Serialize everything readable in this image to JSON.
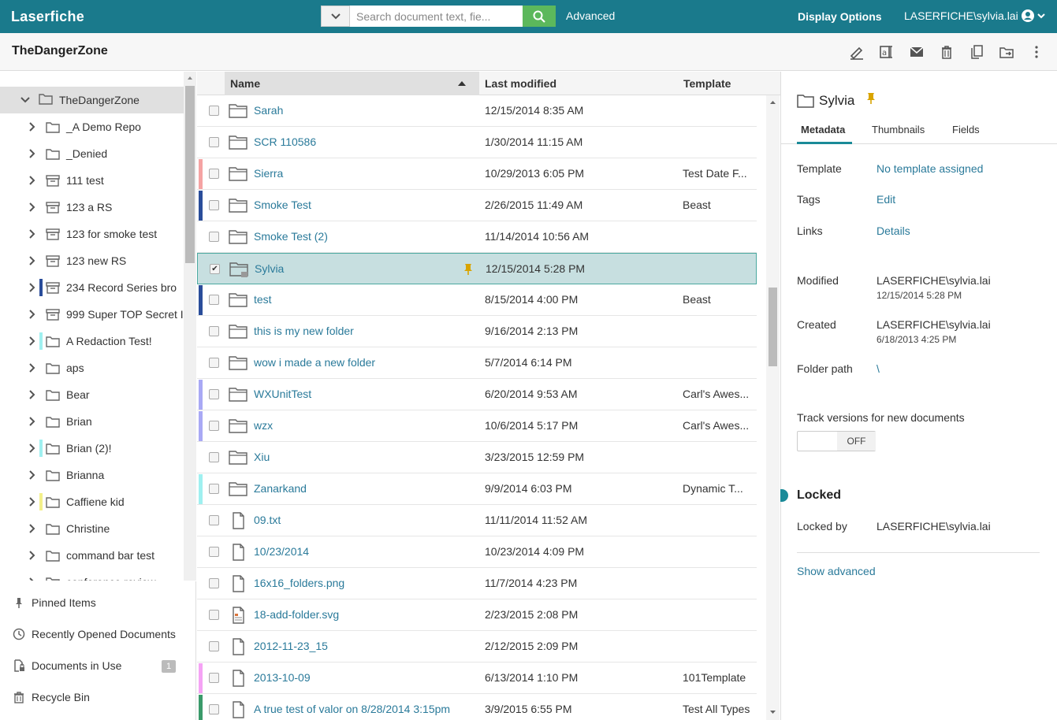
{
  "app": {
    "brand": "Laserfiche"
  },
  "search": {
    "placeholder": "Search document text, fie...",
    "advanced_label": "Advanced"
  },
  "header": {
    "display_options": "Display Options",
    "user": "LASERFICHE\\sylvia.lai"
  },
  "page": {
    "title": "TheDangerZone"
  },
  "tree": {
    "root": "TheDangerZone",
    "items": [
      {
        "label": "_A Demo Repo",
        "icon": "folder",
        "bar": ""
      },
      {
        "label": "_Denied",
        "icon": "folder",
        "bar": ""
      },
      {
        "label": "111 test",
        "icon": "record-series",
        "bar": ""
      },
      {
        "label": "123 a RS",
        "icon": "record-series",
        "bar": ""
      },
      {
        "label": "123 for smoke test",
        "icon": "record-series",
        "bar": ""
      },
      {
        "label": "123 new RS",
        "icon": "record-series",
        "bar": ""
      },
      {
        "label": "234 Record Series bro",
        "icon": "record-series",
        "bar": "#2a4d9a"
      },
      {
        "label": "999 Super TOP Secret I",
        "icon": "record-series",
        "bar": ""
      },
      {
        "label": "A Redaction Test!",
        "icon": "folder",
        "bar": "#9ff0f0"
      },
      {
        "label": "aps",
        "icon": "folder",
        "bar": ""
      },
      {
        "label": "Bear",
        "icon": "folder",
        "bar": ""
      },
      {
        "label": "Brian",
        "icon": "folder",
        "bar": ""
      },
      {
        "label": "Brian (2)!",
        "icon": "folder",
        "bar": "#9ff0f0"
      },
      {
        "label": "Brianna",
        "icon": "folder",
        "bar": ""
      },
      {
        "label": "Caffiene kid",
        "icon": "folder",
        "bar": "#f3f08a"
      },
      {
        "label": "Christine",
        "icon": "folder",
        "bar": ""
      },
      {
        "label": "command bar test",
        "icon": "folder",
        "bar": ""
      },
      {
        "label": "conference review",
        "icon": "folder",
        "bar": ""
      }
    ]
  },
  "left_bottom": {
    "pinned": "Pinned Items",
    "recent": "Recently Opened Documents",
    "in_use": "Documents in Use",
    "in_use_count": "1",
    "recycle": "Recycle Bin"
  },
  "table": {
    "columns": {
      "name": "Name",
      "modified": "Last modified",
      "template": "Template"
    },
    "rows": [
      {
        "name": "Sarah",
        "modified": "12/15/2014 8:35 AM",
        "template": "",
        "type": "folder",
        "accent": ""
      },
      {
        "name": "SCR 110586",
        "modified": "1/30/2014 11:15 AM",
        "template": "",
        "type": "folder",
        "accent": ""
      },
      {
        "name": "Sierra",
        "modified": "10/29/2013 6:05 PM",
        "template": "Test Date F...",
        "type": "folder",
        "accent": "#f5a3a3"
      },
      {
        "name": "Smoke Test",
        "modified": "2/26/2015 11:49 AM",
        "template": "Beast",
        "type": "folder",
        "accent": "#2a4d9a"
      },
      {
        "name": "Smoke Test (2)",
        "modified": "11/14/2014 10:56 AM",
        "template": "",
        "type": "folder",
        "accent": ""
      },
      {
        "name": "Sylvia",
        "modified": "12/15/2014 5:28 PM",
        "template": "",
        "type": "folder-locked",
        "accent": "",
        "selected": true,
        "pinned": true
      },
      {
        "name": "test",
        "modified": "8/15/2014 4:00 PM",
        "template": "Beast",
        "type": "folder",
        "accent": "#2a4d9a"
      },
      {
        "name": "this is my new folder",
        "modified": "9/16/2014 2:13 PM",
        "template": "",
        "type": "folder",
        "accent": ""
      },
      {
        "name": "wow i made a new folder",
        "modified": "5/7/2014 6:14 PM",
        "template": "",
        "type": "folder",
        "accent": ""
      },
      {
        "name": "WXUnitTest",
        "modified": "6/20/2014 9:53 AM",
        "template": "Carl's Awes...",
        "type": "folder",
        "accent": "#a9a9f5"
      },
      {
        "name": "wzx",
        "modified": "10/6/2014 5:17 PM",
        "template": "Carl's Awes...",
        "type": "folder",
        "accent": "#a9a9f5"
      },
      {
        "name": "Xiu",
        "modified": "3/23/2015 12:59 PM",
        "template": "",
        "type": "folder",
        "accent": ""
      },
      {
        "name": "Zanarkand",
        "modified": "9/9/2014 6:03 PM",
        "template": "Dynamic T...",
        "type": "folder",
        "accent": "#9ff0f0"
      },
      {
        "name": "09.txt",
        "modified": "11/11/2014 11:52 AM",
        "template": "",
        "type": "document",
        "accent": ""
      },
      {
        "name": "10/23/2014",
        "modified": "10/23/2014 4:09 PM",
        "template": "",
        "type": "document",
        "accent": ""
      },
      {
        "name": "16x16_folders.png",
        "modified": "11/7/2014 4:23 PM",
        "template": "",
        "type": "document",
        "accent": ""
      },
      {
        "name": "18-add-folder.svg",
        "modified": "2/23/2015 2:08 PM",
        "template": "",
        "type": "document-image",
        "accent": ""
      },
      {
        "name": "2012-11-23_15",
        "modified": "2/12/2015 2:09 PM",
        "template": "",
        "type": "document",
        "accent": ""
      },
      {
        "name": "2013-10-09",
        "modified": "6/13/2014 1:10 PM",
        "template": "101Template",
        "type": "document",
        "accent": "#f5a3f5"
      },
      {
        "name": "A true test of valor on 8/28/2014 3:15pm",
        "modified": "3/9/2015 6:55 PM",
        "template": "Test All Types",
        "type": "document",
        "accent": "#3a9a6a"
      }
    ]
  },
  "panel": {
    "title": "Sylvia",
    "tabs": [
      "Metadata",
      "Thumbnails",
      "Fields"
    ],
    "template_label": "Template",
    "template_value": "No template assigned",
    "tags_label": "Tags",
    "tags_value": "Edit",
    "links_label": "Links",
    "links_value": "Details",
    "modified_label": "Modified",
    "modified_by": "LASERFICHE\\sylvia.lai",
    "modified_date": "12/15/2014 5:28 PM",
    "created_label": "Created",
    "created_by": "LASERFICHE\\sylvia.lai",
    "created_date": "6/18/2013 4:25 PM",
    "path_label": "Folder path",
    "path_value": "\\",
    "track_label": "Track versions for new documents",
    "toggle_state": "OFF",
    "locked_heading": "Locked",
    "locked_by_label": "Locked by",
    "locked_by_value": "LASERFICHE\\sylvia.lai",
    "show_advanced": "Show advanced"
  },
  "colors": {
    "brand": "#1a7a8c",
    "search_button": "#5cb85c",
    "link": "#2a7a9a",
    "pin": "#d9a400"
  }
}
